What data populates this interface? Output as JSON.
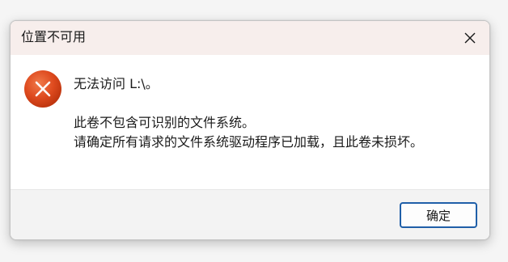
{
  "dialog": {
    "title": "位置不可用",
    "message_main": "无法访问 L:\\。",
    "message_detail_line1": "此卷不包含可识别的文件系统。",
    "message_detail_line2": "请确定所有请求的文件系统驱动程序已加载，且此卷未损坏。",
    "ok_label": "确定",
    "icon": "error-icon",
    "close_icon": "close-icon"
  },
  "colors": {
    "titlebar_bg": "#f7eeec",
    "error_red": "#d9421b",
    "button_border": "#1f5fa8",
    "footer_bg": "#f3f3f3"
  }
}
